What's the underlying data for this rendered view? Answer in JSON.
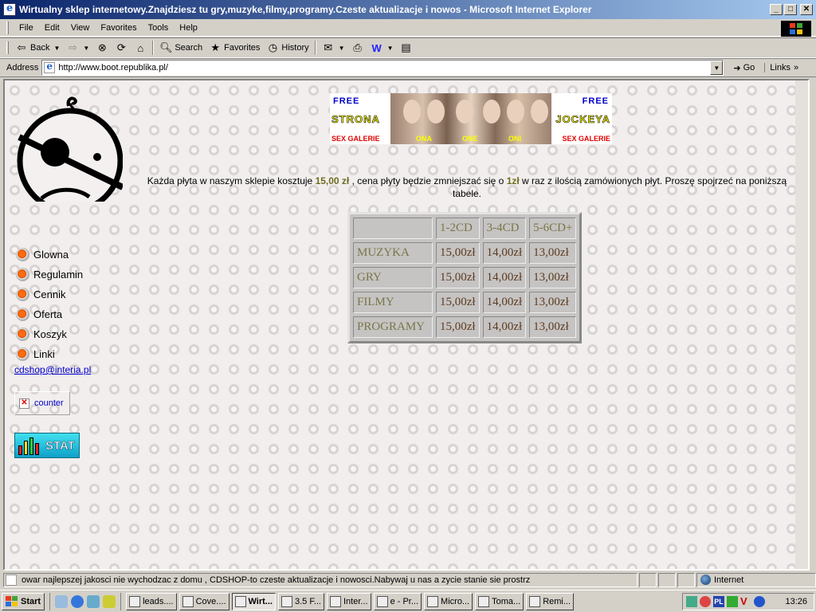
{
  "window": {
    "title": "Wirtualny sklep internetowy.Znajdziesz tu gry,muzyke,filmy,programy.Czeste aktualizacje i nowos - Microsoft Internet Explorer",
    "minimize": "_",
    "maximize": "□",
    "close": "✕"
  },
  "menu": [
    "File",
    "Edit",
    "View",
    "Favorites",
    "Tools",
    "Help"
  ],
  "toolbar": {
    "back": "Back",
    "search": "Search",
    "favorites": "Favorites",
    "history": "History"
  },
  "address": {
    "label": "Address",
    "url": "http://www.boot.republika.pl/",
    "go": "Go",
    "links": "Links"
  },
  "banner": {
    "free_left": "FREE",
    "free_right": "FREE",
    "strona": "STRONA",
    "jockeya": "JOCKEYA",
    "sex_left": "SEX GALERIE",
    "sex_right": "SEX GALERIE",
    "ona": "ONA",
    "one": "ONE",
    "oni": "ONI"
  },
  "intro": {
    "part1": "Każda płyta w naszym sklepie kosztuje ",
    "price": "15,00 zł",
    "part2": " , cena płyty będzie zmniejszać się o ",
    "discount": "1zł",
    "part3": " w raz z ilością zamówionych płyt. Proszę spojrzeć na poniższą tabele."
  },
  "price_table": {
    "headers": [
      "",
      "1-2CD",
      "3-4CD",
      "5-6CD+"
    ],
    "rows": [
      {
        "category": "MUZYKA",
        "p1": "15,00zł",
        "p2": "14,00zł",
        "p3": "13,00zł"
      },
      {
        "category": "GRY",
        "p1": "15,00zł",
        "p2": "14,00zł",
        "p3": "13,00zł"
      },
      {
        "category": "FILMY",
        "p1": "15,00zł",
        "p2": "14,00zł",
        "p3": "13,00zł"
      },
      {
        "category": "PROGRAMY",
        "p1": "15,00zł",
        "p2": "14,00zł",
        "p3": "13,00zł"
      }
    ]
  },
  "nav": [
    "Glowna",
    "Regulamin",
    "Cennik",
    "Oferta",
    "Koszyk",
    "Linki"
  ],
  "email": "cdshop@interia.pl",
  "counter": "counter",
  "stat": "STAT",
  "status": {
    "text": "owar najlepszej jakosci nie wychodzac z domu , CDSHOP-to czeste aktualizacje i nowosci.Nabywaj u nas a zycie stanie sie prostrz",
    "zone": "Internet"
  },
  "taskbar": {
    "start": "Start",
    "tasks": [
      {
        "label": "leads....",
        "active": false
      },
      {
        "label": "Cove....",
        "active": false
      },
      {
        "label": "Wirt...",
        "active": true
      },
      {
        "label": "3.5 F...",
        "active": false
      },
      {
        "label": "Inter...",
        "active": false
      },
      {
        "label": "e - Pr...",
        "active": false
      },
      {
        "label": "Micro...",
        "active": false
      },
      {
        "label": "Toma...",
        "active": false
      },
      {
        "label": "Remi...",
        "active": false
      }
    ],
    "tray_lang": "PL",
    "clock": "13:26"
  },
  "colors": {
    "titlebar_start": "#0a246a",
    "titlebar_end": "#a6caf0",
    "price_text": "#6d6d1f",
    "table_bg": "#c6c3c3",
    "bullet": "#ff6a10",
    "link": "#0000cc"
  }
}
